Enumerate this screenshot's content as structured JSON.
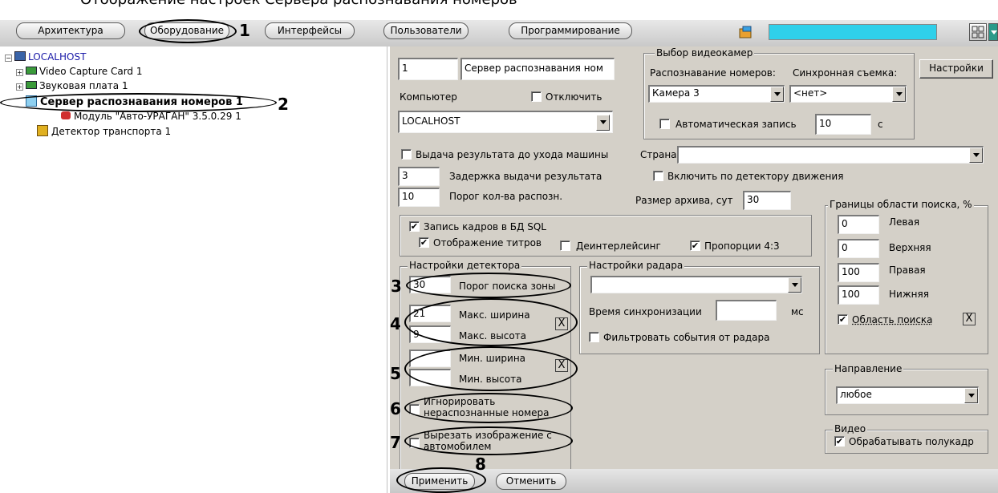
{
  "header": {
    "caption": "Отображение настроек Сервера распознавания номеров",
    "tabs": [
      {
        "label": "Архитектура"
      },
      {
        "label": "Оборудование"
      },
      {
        "label": "Интерфейсы"
      },
      {
        "label": "Пользователи"
      },
      {
        "label": "Программирование"
      }
    ],
    "search_color": "#2fd0ea"
  },
  "callouts": [
    "1",
    "2",
    "3",
    "4",
    "5",
    "6",
    "7",
    "8"
  ],
  "tree": {
    "root": "LOCALHOST",
    "items": [
      {
        "label": "Video Capture Card 1"
      },
      {
        "label": "Звуковая плата 1"
      },
      {
        "label": "Сервер распознавания номеров 1"
      },
      {
        "label": "Модуль \"Авто-УРАГАН\" 3.5.0.29 1"
      },
      {
        "label": "Детектор транспорта 1"
      }
    ]
  },
  "settings": {
    "id_value": "1",
    "name_value": "Сервер распознавания ном",
    "computer_label": "Компьютер",
    "disable_label": "Отключить",
    "computer_value": "LOCALHOST",
    "cams_group": "Выбор видеокамер",
    "recog_label": "Распознавание номеров:",
    "sync_label": "Синхронная съемка:",
    "settings_button": "Настройки",
    "camera_value": "Камера 3",
    "sync_value": "<нет>",
    "autorec_label": "Автоматическая запись",
    "autorec_value": "10",
    "autorec_unit": "с",
    "issue_label": "Выдача результата до ухода машины",
    "country_label": "Страна:",
    "country_value": "",
    "delay_value": "3",
    "delay_label": "Задержка выдачи результата",
    "motion_label": "Включить по детектору движения",
    "threshold_value": "10",
    "threshold_label": "Порог кол-ва распозн.",
    "archive_label": "Размер архива, сут",
    "archive_value": "30",
    "sql_label": "Запись кадров в БД SQL",
    "titles_label": "Отображение титров",
    "deinterlace_label": "Деинтерлейсинг",
    "aspect_label": "Пропорции 4:3",
    "bounds_group": "Границы области поиска, %",
    "left_value": "0",
    "left_label": "Левая",
    "top_value": "0",
    "top_label": "Верхняя",
    "right_value": "100",
    "right_label": "Правая",
    "bottom_value": "100",
    "bottom_label": "Нижняя",
    "area_label": "Область поиска",
    "detector_group": "Настройки детектора",
    "zone_value": "30",
    "zone_label": "Порог поиска зоны",
    "maxw_value": "21",
    "maxw_label": "Макс. ширина",
    "maxh_value": "9",
    "maxh_label": "Макс. высота",
    "minw_value": "",
    "minw_label": "Мин. ширина",
    "minh_value": "",
    "minh_label": "Мин. высота",
    "ignore_label": "Игнорировать нераспознанные номера",
    "cut_label": "Вырезать изображение с автомобилем",
    "radar_group": "Настройки радара",
    "radar_value": "",
    "sync_time_label": "Время синхронизации",
    "sync_time_value": "",
    "sync_time_unit": "мс",
    "radar_filter_label": "Фильтровать события от радара",
    "direction_group": "Направление",
    "direction_value": "любое",
    "video_group": "Видео",
    "halfframe_label": "Обрабатывать полукадр",
    "x_glyph": "X",
    "check_glyph": "✔"
  },
  "footer": {
    "apply_label": "Применить",
    "cancel_label": "Отменить"
  }
}
